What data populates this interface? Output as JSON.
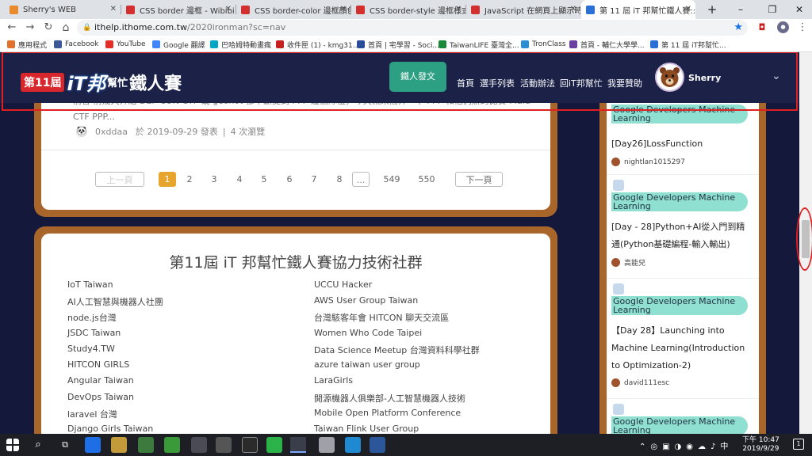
{
  "browser": {
    "tabs": [
      {
        "title": "Sherry's WEB",
        "color": "#e98a2c"
      },
      {
        "title": "CSS border 邊框 - Wibibi",
        "color": "#d32f2f"
      },
      {
        "title": "CSS border-color 邊框顏色",
        "color": "#d32f2f"
      },
      {
        "title": "CSS border-style 邊框樣式",
        "color": "#d32f2f"
      },
      {
        "title": "JavaScript 在網頁上顯示時間",
        "color": "#d32f2f"
      },
      {
        "title": "第 11 屆 iT 邦幫忙鐵人賽::用",
        "color": "#2a6fd6"
      }
    ],
    "new_tab": "+",
    "window_controls": [
      "–",
      "❐",
      "✕"
    ],
    "url_host": "ithelp.ithome.com.tw",
    "url_path": "/2020ironman?sc=nav",
    "bookmarks": [
      {
        "label": "應用程式",
        "color": "#e0702b"
      },
      {
        "label": "Facebook",
        "color": "#3b5998"
      },
      {
        "label": "YouTube",
        "color": "#e52d27"
      },
      {
        "label": "Google 翻譯",
        "color": "#4285f4"
      },
      {
        "label": "巴哈姆特動畫瘋",
        "color": "#00a7c8"
      },
      {
        "label": "收件匣 (1) - kmg31...",
        "color": "#c5221f"
      },
      {
        "label": "首頁 | 宅學習 - Soci...",
        "color": "#2b4c99"
      },
      {
        "label": "TaiwanLIFE 臺灣全...",
        "color": "#1a8a3a"
      },
      {
        "label": "TronClass",
        "color": "#2b8fd7"
      },
      {
        "label": "首頁 - 輔仁大學學...",
        "color": "#6c3fa0"
      },
      {
        "label": "第 11 屆 iT邦幫忙...",
        "color": "#2a6fd6"
      }
    ]
  },
  "header": {
    "logo_prefix": "第11屆",
    "logo_it": "iT邦",
    "logo_help": "幫忙",
    "logo_suffix": "鐵人賽",
    "post_button": "鐵人發文",
    "nav": [
      "首頁",
      "選手列表",
      "活動辦法",
      "回iT邦幫忙",
      "我要贊助"
    ],
    "user_name": "Sherry",
    "chevron": "⌄"
  },
  "article": {
    "snippet": "前言 前幾天介紹 DEF CON CTF 或 geohot 都不斷提到 PPP 這個隊伍，今天就來簡介一下 PPP 和他們辦的比賽 Plaid CTF PPP...",
    "author": "0xddaa",
    "date_text": "於 2019-09-29 發表",
    "separator": "|",
    "views": "4 次瀏覽"
  },
  "pagination": {
    "prev": "上一頁",
    "pages": [
      "1",
      "2",
      "3",
      "4",
      "5",
      "6",
      "7",
      "8"
    ],
    "ellipsis": "...",
    "tail": [
      "549",
      "550"
    ],
    "next": "下一頁",
    "current": "1"
  },
  "community": {
    "title": "第11屆 iT 邦幫忙鐵人賽協力技術社群",
    "left": [
      "IoT Taiwan",
      "AI人工智慧與機器人社團",
      "node.js台灣",
      "JSDC Taiwan",
      "Study4.TW",
      "HITCON GIRLS",
      "Angular Taiwan",
      "DevOps Taiwan",
      "laravel 台灣",
      "Django Girls Taiwan"
    ],
    "right": [
      "UCCU Hacker",
      "AWS User Group Taiwan",
      "台灣駭客年會 HITCON 聊天交流區",
      "Women Who Code Taipei",
      "Data Science Meetup 台灣資料科學社群",
      "azure taiwan user group",
      "LaraGirls",
      "開源機器人俱樂部-人工智慧機器人技術",
      "Mobile Open Platform Conference",
      "Taiwan Flink User Group"
    ]
  },
  "sidebar": {
    "items": [
      {
        "tag": "Google Developers Machine Learning",
        "title": "[Day26]LossFunction",
        "author": "nightlan1015297"
      },
      {
        "tag": "Google Developers Machine Learning",
        "title": "[Day - 28]Python+AI從入門到精通(Python基礎編程-輸入輸出)",
        "author": "高能兒"
      },
      {
        "tag": "Google Developers Machine Learning",
        "title": "【Day 28】Launching into Machine Learning(Introduction to Optimization-2)",
        "author": "david111esc"
      },
      {
        "tag": "Google Developers Machine Learning",
        "title": "",
        "author": ""
      }
    ]
  },
  "taskbar": {
    "time": "下午 10:47",
    "date": "2019/9/29",
    "notification_count": "1"
  }
}
